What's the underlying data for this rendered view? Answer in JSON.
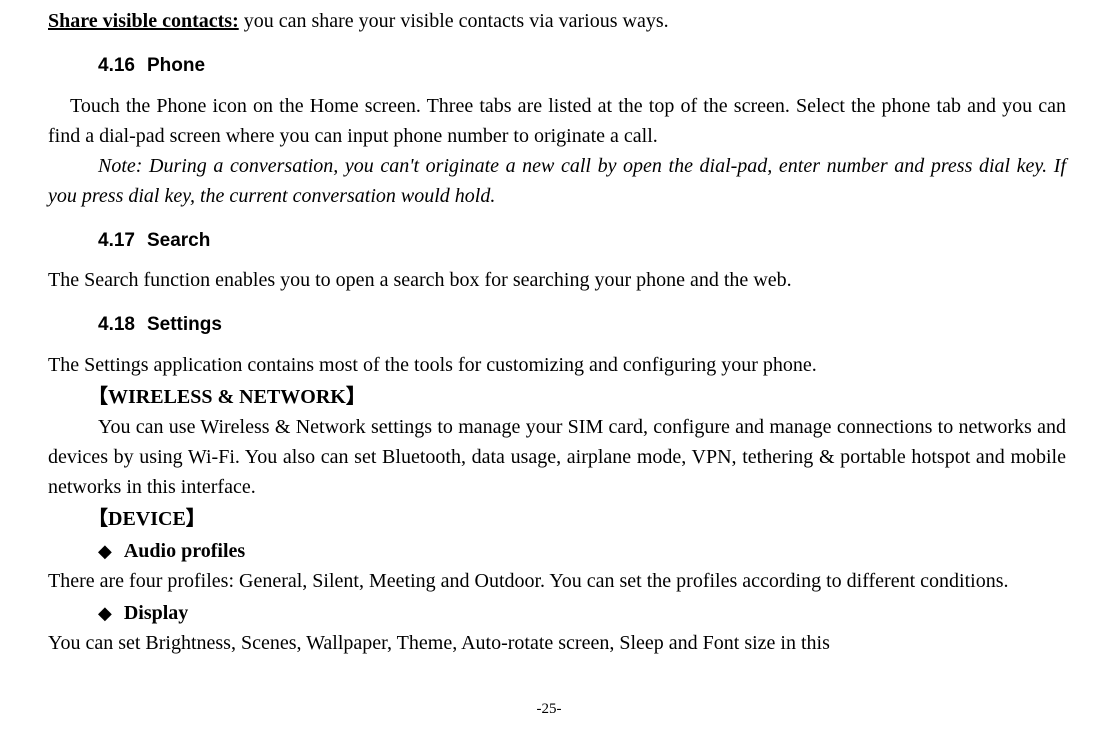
{
  "share": {
    "label": "Share visible contacts:",
    "text": " you can share your visible contacts via various ways."
  },
  "section416": {
    "num": "4.16",
    "title": "Phone",
    "para": "Touch the Phone icon on the Home screen. Three tabs are listed at the top of the screen. Select the phone tab and you can find a dial-pad screen where you can input phone number to originate a call.",
    "note": "Note: During a conversation, you can't originate a new call by open the dial-pad, enter number and press dial key. If you press dial key, the current conversation would hold."
  },
  "section417": {
    "num": "4.17",
    "title": "Search",
    "para": "The Search function enables you to open a search box for searching your phone and the web."
  },
  "section418": {
    "num": "4.18",
    "title": "Settings",
    "para": "The Settings application contains most of the tools for customizing and configuring your phone.",
    "wirelessHeading": "【WIRELESS & NETWORK】",
    "wirelessPara": "You can use Wireless & Network settings to manage your SIM card, configure and manage connections to networks and devices by using Wi-Fi. You also can set Bluetooth, data usage, airplane mode, VPN, tethering & portable hotspot and mobile networks in this interface.",
    "deviceHeading": "【DEVICE】",
    "audio": {
      "bullet": "◆",
      "label": "Audio profiles",
      "para": "There are four profiles: General, Silent, Meeting and Outdoor. You can set the profiles according to different conditions."
    },
    "display": {
      "bullet": "◆",
      "label": "Display",
      "para": "You can set Brightness, Scenes, Wallpaper, Theme, Auto-rotate screen, Sleep and Font size in this"
    }
  },
  "pageNumber": "-25-"
}
